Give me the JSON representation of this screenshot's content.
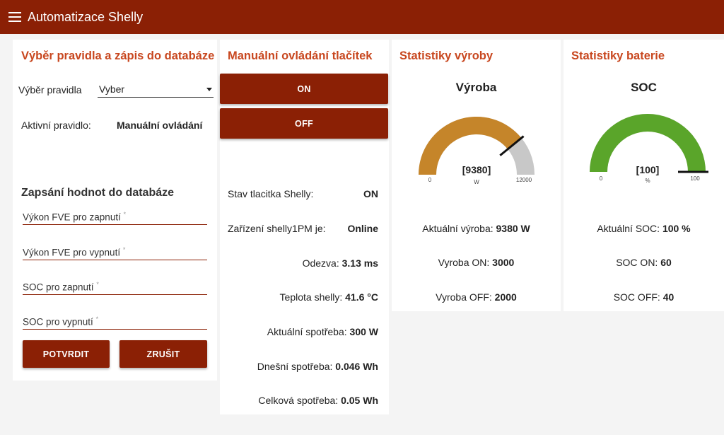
{
  "app": {
    "title": "Automatizace Shelly",
    "menu_icon": "hamburger-menu-icon"
  },
  "colors": {
    "primary": "#8b2005",
    "accent": "#c8471f",
    "gauge_production": "#c5852a",
    "gauge_soc": "#5aa52a",
    "gauge_bg": "#c8c8c8"
  },
  "rule": {
    "title": "Výběr pravidla a zápis do databáze",
    "select_label": "Výběr pravidla",
    "select_value": "Vyber",
    "active_label": "Aktivní pravidlo:",
    "active_value": "Manuální ovládání",
    "db_title": "Zapsání hodnot do databáze",
    "fields": [
      {
        "label": "Výkon FVE pro zapnutí",
        "required": "*"
      },
      {
        "label": "Výkon FVE pro vypnutí",
        "required": "*"
      },
      {
        "label": "SOC pro zapnutí",
        "required": "*"
      },
      {
        "label": "SOC pro vypnutí",
        "required": "*"
      }
    ],
    "confirm_label": "POTVRDIT",
    "cancel_label": "ZRUŠIT"
  },
  "manual": {
    "title": "Manuální ovládání tlačítek",
    "on_label": "ON",
    "off_label": "OFF",
    "state_label": "Stav tlacitka Shelly:",
    "state_value": "ON",
    "device_label": "Zařízení shelly1PM je:",
    "device_value": "Online",
    "latency_label": "Odezva:",
    "latency_value": "3.13 ms",
    "temp_label": "Teplota shelly:",
    "temp_value": "41.6 °C",
    "current_label": "Aktuální spotřeba:",
    "current_value": "300 W",
    "today_label": "Dnešní spotřeba:",
    "today_value": "0.046 Wh",
    "total_label": "Celková spotřeba:",
    "total_value": "0.05 Wh"
  },
  "production": {
    "title": "Statistiky výroby",
    "gauge_title": "Výroba",
    "gauge_value": 9380,
    "gauge_value_text": "[9380]",
    "gauge_min": "0",
    "gauge_max": "12000",
    "gauge_unit": "W",
    "current_label": "Aktuální výroba:",
    "current_value": "9380 W",
    "on_label": "Vyroba ON:",
    "on_value": "3000",
    "off_label": "Vyroba OFF:",
    "off_value": "2000"
  },
  "battery": {
    "title": "Statistiky baterie",
    "gauge_title": "SOC",
    "gauge_value": 100,
    "gauge_value_text": "[100]",
    "gauge_min": "0",
    "gauge_max": "100",
    "gauge_unit": "%",
    "current_label": "Aktuální SOC:",
    "current_value": "100 %",
    "on_label": "SOC ON:",
    "on_value": "60",
    "off_label": "SOC OFF:",
    "off_value": "40"
  }
}
